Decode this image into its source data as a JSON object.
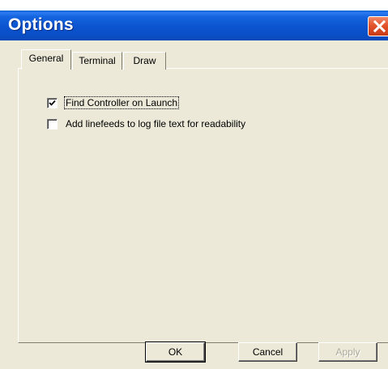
{
  "window": {
    "title": "Options"
  },
  "tabs": [
    {
      "label": "General",
      "active": true
    },
    {
      "label": "Terminal",
      "active": false
    },
    {
      "label": "Draw",
      "active": false
    }
  ],
  "options": [
    {
      "label": "Find Controller on Launch",
      "checked": true
    },
    {
      "label": "Add linefeeds to log file text for readability",
      "checked": false
    }
  ],
  "buttons": {
    "ok_label": "OK",
    "cancel_label": "Cancel",
    "apply_label": "Apply",
    "apply_enabled": false
  },
  "icons": {
    "close": "close-icon",
    "check": "checkmark-icon"
  },
  "colors": {
    "titlebar": "#0b53cf",
    "close_button": "#e3532c",
    "dialog_face": "#ece9d8",
    "disabled_text": "#aca899"
  }
}
